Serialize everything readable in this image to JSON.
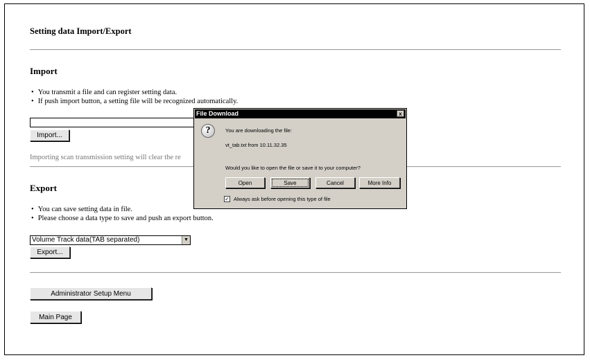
{
  "page": {
    "title": "Setting data Import/Export"
  },
  "import": {
    "heading": "Import",
    "bullets": [
      "You transmit a file and can register setting data.",
      "If push import button, a setting file will be recognized automatically."
    ],
    "file_value": "",
    "import_button": "Import...",
    "note": "Importing scan transmission setting will clear the re"
  },
  "export": {
    "heading": "Export",
    "bullets": [
      "You can save setting data in file.",
      "Please choose a data type to save and push an export button."
    ],
    "data_type_selected": "Volume Track data(TAB separated)",
    "export_button": "Export..."
  },
  "nav": {
    "admin_button": "Administrator Setup Menu",
    "main_button": "Main Page"
  },
  "dialog": {
    "title": "File Download",
    "close": "x",
    "line1": "You are downloading the file:",
    "line2": "vt_tab.txt from 10.11.32.35",
    "question": "Would you like to open the file or save it to your computer?",
    "buttons": {
      "open": "Open",
      "save": "Save",
      "cancel": "Cancel",
      "more_info": "More Info"
    },
    "checkbox_label": "Always ask before opening this type of file",
    "checkbox_checked": true
  }
}
